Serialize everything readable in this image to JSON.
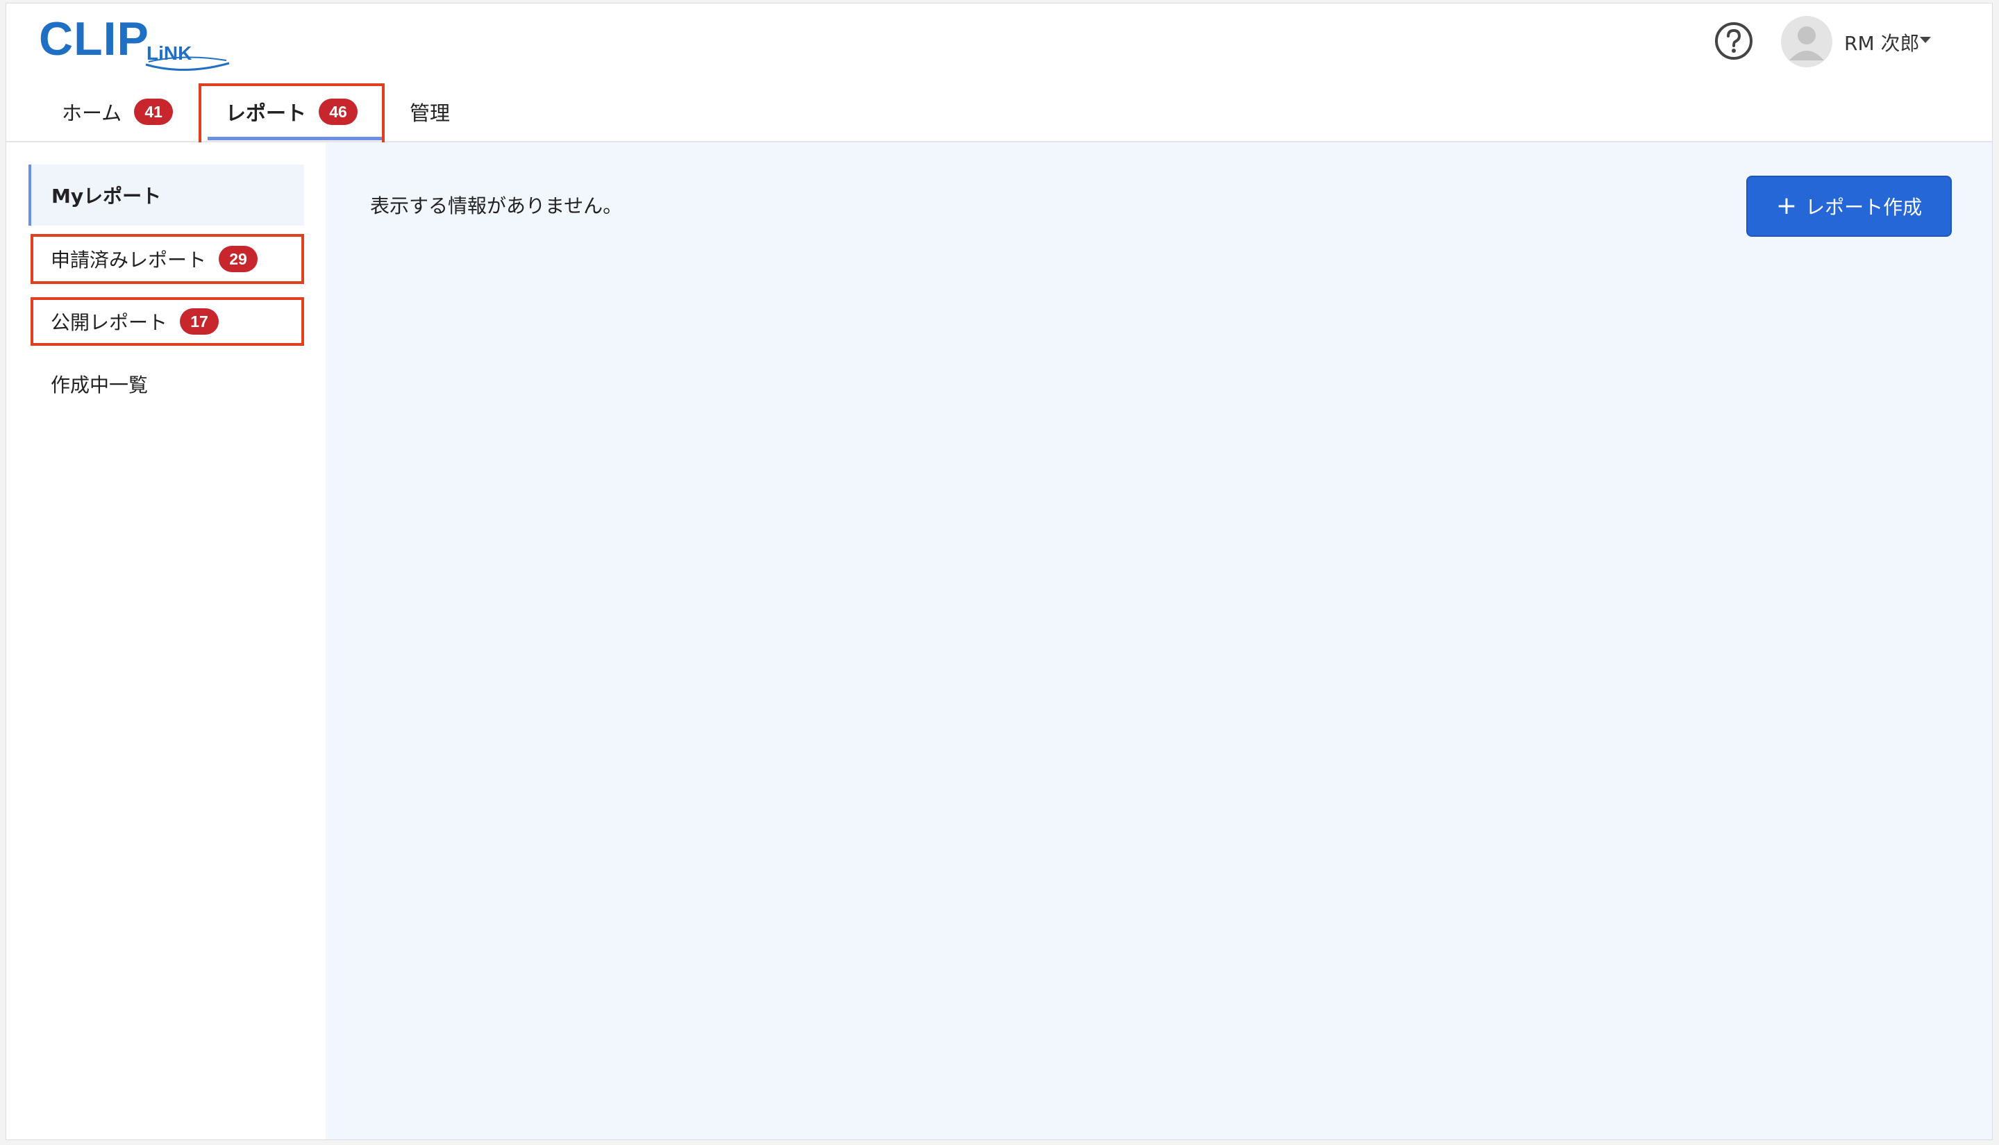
{
  "header": {
    "logo_main": "CLIP",
    "logo_sub": "LiNK",
    "help_icon": "question-circle-icon",
    "user_name": "RM 次郎"
  },
  "tabs": [
    {
      "label": "ホーム",
      "count": "41",
      "active": false
    },
    {
      "label": "レポート",
      "count": "46",
      "active": true
    },
    {
      "label": "管理",
      "count": null,
      "active": false
    }
  ],
  "sidebar": {
    "items": [
      {
        "label": "Myレポート",
        "count": null,
        "active": true
      },
      {
        "label": "申請済みレポート",
        "count": "29",
        "active": false
      },
      {
        "label": "公開レポート",
        "count": "17",
        "active": false
      },
      {
        "label": "作成中一覧",
        "count": null,
        "active": false
      }
    ]
  },
  "main": {
    "empty_message": "表示する情報がありません。",
    "create_button_label": "レポート作成",
    "create_button_icon": "plus-icon"
  },
  "colors": {
    "brand": "#1f6fc5",
    "primary_button": "#2667d8",
    "badge": "#c6262c",
    "highlight": "#e0401f",
    "content_bg": "#f2f7fd"
  }
}
